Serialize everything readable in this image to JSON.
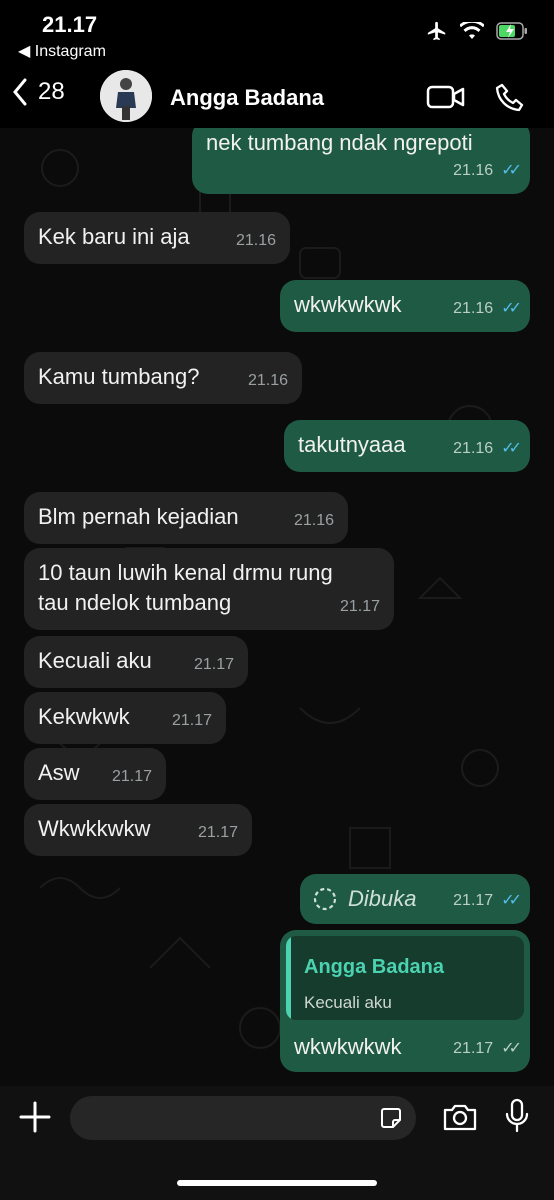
{
  "status_bar": {
    "time": "21.17",
    "back_app": "Instagram"
  },
  "header": {
    "back_count": "28",
    "contact_name": "Angga Badana"
  },
  "messages": [
    {
      "dir": "out",
      "text": "nek tumbang ndak ngrepoti",
      "time": "21.16",
      "status": "read"
    },
    {
      "dir": "in",
      "text": "Kek baru ini aja",
      "time": "21.16"
    },
    {
      "dir": "out",
      "text": "wkwkwkwk",
      "time": "21.16",
      "status": "read"
    },
    {
      "dir": "in",
      "text": "Kamu tumbang?",
      "time": "21.16"
    },
    {
      "dir": "out",
      "text": "takutnyaaa",
      "time": "21.16",
      "status": "read"
    },
    {
      "dir": "in",
      "text": "Blm pernah kejadian",
      "time": "21.16"
    },
    {
      "dir": "in",
      "text_line1": "10 taun luwih kenal drmu rung",
      "text_line2": "tau ndelok tumbang",
      "time": "21.17"
    },
    {
      "dir": "in",
      "text": "Kecuali aku",
      "time": "21.17"
    },
    {
      "dir": "in",
      "text": "Kekwkwk",
      "time": "21.17"
    },
    {
      "dir": "in",
      "text": "Asw",
      "time": "21.17"
    },
    {
      "dir": "in",
      "text": "Wkwkkwkw",
      "time": "21.17"
    },
    {
      "dir": "out",
      "text": "Dibuka",
      "time": "21.17",
      "status": "read",
      "kind": "view-once-opened"
    },
    {
      "dir": "out",
      "text": "wkwkwkwk",
      "time": "21.17",
      "status": "delivered",
      "reply_to": {
        "name": "Angga Badana",
        "text": "Kecuali aku"
      }
    }
  ],
  "colors": {
    "outgoing": "#1f5a44",
    "incoming": "#232323",
    "read_ticks": "#53bdeb",
    "quote_accent": "#4bd2b0"
  }
}
